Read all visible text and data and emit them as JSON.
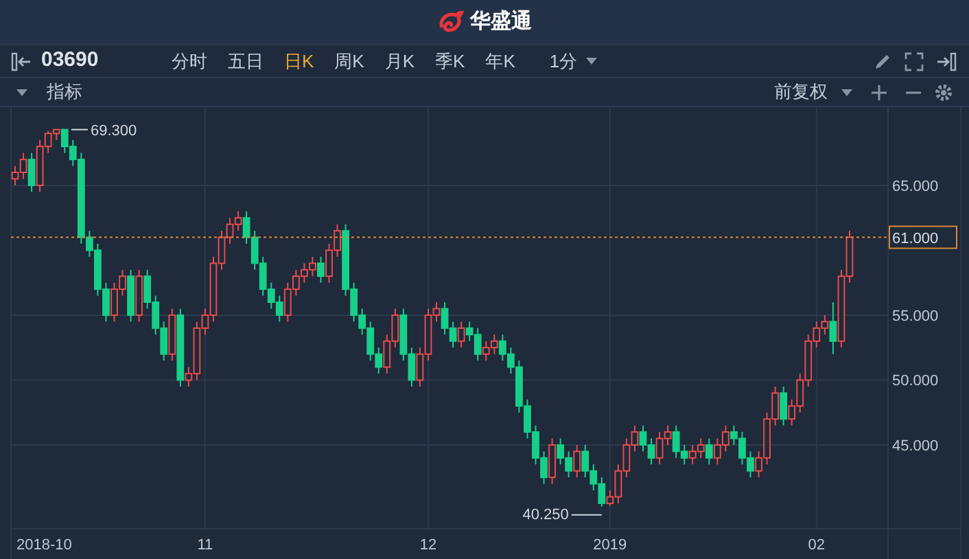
{
  "header": {
    "logo_text": "华盛通"
  },
  "toolbar": {
    "symbol": "03690",
    "periods": [
      {
        "label": "分时",
        "selected": false
      },
      {
        "label": "五日",
        "selected": false
      },
      {
        "label": "日K",
        "selected": true
      },
      {
        "label": "周K",
        "selected": false
      },
      {
        "label": "月K",
        "selected": false
      },
      {
        "label": "季K",
        "selected": false
      },
      {
        "label": "年K",
        "selected": false
      }
    ],
    "interval": "1分"
  },
  "indicator_bar": {
    "label": "指标",
    "adjust": "前复权"
  },
  "chart": {
    "high_mark": "69.300",
    "low_mark": "40.250",
    "x_axis_labels": [
      "2018-10",
      "11",
      "12",
      "2019",
      "02"
    ],
    "chart_data": {
      "type": "candlestick",
      "ylim": [
        38.54,
        71.03
      ],
      "grid": true,
      "ref_lines": [
        {
          "axis": "y",
          "value": 61,
          "label": "61.000",
          "color": "#d8893a"
        }
      ],
      "yticks": [
        {
          "value": 65,
          "label": "65.000"
        },
        {
          "value": 55,
          "label": "55.000"
        },
        {
          "value": 50,
          "label": "50.000"
        },
        {
          "value": 45,
          "label": "45.000"
        }
      ],
      "ohlc": [
        [
          65.5,
          66.5,
          65,
          66
        ],
        [
          66,
          67.5,
          65.5,
          67
        ],
        [
          67,
          67.5,
          64.5,
          65
        ],
        [
          65,
          68.5,
          64.5,
          68
        ],
        [
          68,
          69.2,
          67.5,
          69
        ],
        [
          69,
          69.3,
          68.5,
          69.3
        ],
        [
          69.3,
          69.3,
          67.5,
          68
        ],
        [
          68,
          68.5,
          66.5,
          67
        ],
        [
          67,
          67.5,
          60.5,
          61
        ],
        [
          61,
          61.5,
          59.5,
          60
        ],
        [
          60,
          60.5,
          56.5,
          57
        ],
        [
          57,
          57.5,
          54.5,
          55
        ],
        [
          55,
          57.5,
          54.5,
          57
        ],
        [
          57,
          58.5,
          56.5,
          58
        ],
        [
          58,
          58.5,
          54.5,
          55
        ],
        [
          55,
          58.5,
          54.5,
          58
        ],
        [
          58,
          58.5,
          55.5,
          56
        ],
        [
          56,
          56.5,
          53.5,
          54
        ],
        [
          54,
          54.5,
          51.5,
          52
        ],
        [
          52,
          55.5,
          51.5,
          55
        ],
        [
          55,
          55.5,
          49.5,
          50
        ],
        [
          50,
          51,
          49.5,
          50.5
        ],
        [
          50.5,
          54.5,
          50,
          54
        ],
        [
          54,
          55.5,
          53.5,
          55
        ],
        [
          55,
          59.5,
          54.5,
          59
        ],
        [
          59,
          61.5,
          58.5,
          61
        ],
        [
          61,
          62.5,
          60.5,
          62
        ],
        [
          62,
          63,
          61.5,
          62.5
        ],
        [
          62.5,
          63,
          60.5,
          61
        ],
        [
          61,
          61.5,
          58.5,
          59
        ],
        [
          59,
          59.5,
          56.5,
          57
        ],
        [
          57,
          57.5,
          55.5,
          56
        ],
        [
          56,
          56.5,
          54.5,
          55
        ],
        [
          55,
          57.5,
          54.5,
          57
        ],
        [
          57,
          58.5,
          56.5,
          58
        ],
        [
          58,
          59,
          57.5,
          58.5
        ],
        [
          58.5,
          59.5,
          58,
          59
        ],
        [
          59,
          59.5,
          57.5,
          58
        ],
        [
          58,
          60.5,
          57.5,
          60
        ],
        [
          60,
          62,
          59.5,
          61.5
        ],
        [
          61.5,
          62,
          56.5,
          57
        ],
        [
          57,
          57.5,
          54.5,
          55
        ],
        [
          55,
          55.5,
          53.5,
          54
        ],
        [
          54,
          54.5,
          51.5,
          52
        ],
        [
          52,
          52.5,
          50.5,
          51
        ],
        [
          51,
          53.5,
          50.5,
          53
        ],
        [
          53,
          55.5,
          52.5,
          55
        ],
        [
          55,
          55.5,
          51.5,
          52
        ],
        [
          52,
          52.5,
          49.5,
          50
        ],
        [
          50,
          52.5,
          49.5,
          52
        ],
        [
          52,
          55.5,
          51.5,
          55
        ],
        [
          55,
          56,
          54.5,
          55.5
        ],
        [
          55.5,
          56,
          53.5,
          54
        ],
        [
          54,
          54.5,
          52.5,
          53
        ],
        [
          53,
          54.5,
          52.5,
          54
        ],
        [
          54,
          54.5,
          53,
          53.5
        ],
        [
          53.5,
          54,
          51.5,
          52
        ],
        [
          52,
          53,
          51.5,
          52.5
        ],
        [
          52.5,
          53.5,
          52,
          53
        ],
        [
          53,
          53.5,
          51.5,
          52
        ],
        [
          52,
          52.5,
          50.5,
          51
        ],
        [
          51,
          51.5,
          47.5,
          48
        ],
        [
          48,
          48.5,
          45.5,
          46
        ],
        [
          46,
          46.5,
          43.5,
          44
        ],
        [
          44,
          44.5,
          42,
          42.5
        ],
        [
          42.5,
          45.5,
          42,
          45
        ],
        [
          45,
          45.5,
          43.5,
          44
        ],
        [
          44,
          44.5,
          42.5,
          43
        ],
        [
          43,
          45,
          42.5,
          44.5
        ],
        [
          44.5,
          45,
          42.5,
          43
        ],
        [
          43,
          43.5,
          41.5,
          42
        ],
        [
          42,
          42.5,
          40.25,
          40.5
        ],
        [
          40.5,
          41.5,
          40.3,
          41
        ],
        [
          41,
          43.5,
          40.5,
          43
        ],
        [
          43,
          45.5,
          42.5,
          45
        ],
        [
          45,
          46.5,
          44.5,
          46
        ],
        [
          46,
          46.5,
          44.5,
          45
        ],
        [
          45,
          45.5,
          43.5,
          44
        ],
        [
          44,
          46,
          43.5,
          45.5
        ],
        [
          45.5,
          46.5,
          45,
          46
        ],
        [
          46,
          46.5,
          44,
          44.5
        ],
        [
          44.5,
          45,
          43.5,
          44
        ],
        [
          44,
          45,
          43.5,
          44.5
        ],
        [
          44.5,
          45.5,
          44,
          45
        ],
        [
          45,
          45.5,
          43.5,
          44
        ],
        [
          44,
          45.5,
          43.5,
          45
        ],
        [
          45,
          46.5,
          44.5,
          46
        ],
        [
          46,
          46.5,
          45,
          45.5
        ],
        [
          45.5,
          46,
          43.5,
          44
        ],
        [
          44,
          44.5,
          42.5,
          43
        ],
        [
          43,
          44.5,
          42.5,
          44
        ],
        [
          44,
          47.5,
          43.5,
          47
        ],
        [
          47,
          49.5,
          46.5,
          49
        ],
        [
          49,
          49.5,
          46.5,
          47
        ],
        [
          47,
          48.5,
          46.5,
          48
        ],
        [
          48,
          50.5,
          47.5,
          50
        ],
        [
          50,
          53.5,
          49.5,
          53
        ],
        [
          53,
          54.5,
          52.5,
          54
        ],
        [
          54,
          55,
          53.5,
          54.5
        ],
        [
          54.5,
          56,
          52,
          53
        ],
        [
          53,
          58.5,
          52.5,
          58
        ],
        [
          58,
          61.5,
          57.5,
          61
        ]
      ]
    }
  }
}
